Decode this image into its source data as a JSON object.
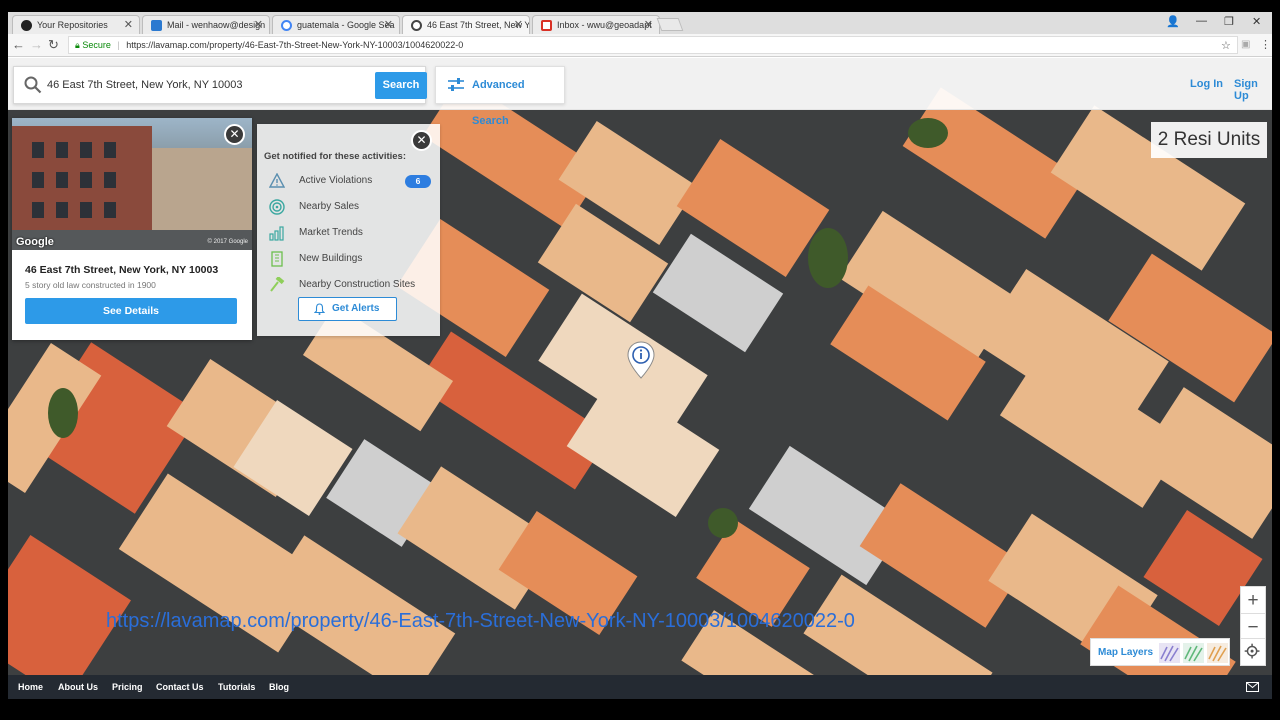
{
  "browser": {
    "tabs": [
      {
        "title": "Your Repositories",
        "icon": "github-icon",
        "color": "#222222"
      },
      {
        "title": "Mail - wenhaow@design",
        "icon": "outlook-icon",
        "color": "#2b79d0"
      },
      {
        "title": "guatemala - Google Sea",
        "icon": "google-icon",
        "color": "#4285f4"
      },
      {
        "title": "46 East 7th Street, New Y",
        "icon": "lavamap-icon",
        "color": "#444444"
      },
      {
        "title": "Inbox - wwu@geoadapt",
        "icon": "gmail-icon",
        "color": "#d93025"
      }
    ],
    "active_tab": 3,
    "secure_label": "Secure",
    "url": "https://lavamap.com/property/46-East-7th-Street-New-York-NY-10003/1004620022-0"
  },
  "header": {
    "search_value": "46 East 7th Street, New York, NY 10003",
    "search_button": "Search",
    "advanced_search": "Advanced Search",
    "login": "Log In",
    "signup": "Sign Up"
  },
  "property_card": {
    "photo_brand": "Google",
    "photo_copyright": "© 2017 Google",
    "address": "46 East 7th Street, New York, NY 10003",
    "description": "5 story old law constructed in 1900",
    "details_button": "See Details"
  },
  "alerts_panel": {
    "title": "Get notified for these activities:",
    "items": [
      {
        "label": "Active Violations",
        "icon": "warning-triangle-icon",
        "badge": "6"
      },
      {
        "label": "Nearby Sales",
        "icon": "target-icon"
      },
      {
        "label": "Market Trends",
        "icon": "bar-chart-icon"
      },
      {
        "label": "New Buildings",
        "icon": "building-icon"
      },
      {
        "label": "Nearby Construction Sites",
        "icon": "hammer-icon"
      }
    ],
    "alerts_button": "Get Alerts"
  },
  "map": {
    "resi_units": "2 Resi Units",
    "overlay_url": "https://lavamap.com/property/46-East-7th-Street-New-York-NY-10003/1004620022-0",
    "zoom_in": "+",
    "zoom_out": "−",
    "map_layers": "Map Layers"
  },
  "footer": {
    "links": [
      "Home",
      "About Us",
      "Pricing",
      "Contact Us",
      "Tutorials",
      "Blog"
    ]
  },
  "colors": {
    "accent_blue": "#2d9ae8",
    "link_blue": "#2d8bd6",
    "footer_bg": "#242a32"
  }
}
